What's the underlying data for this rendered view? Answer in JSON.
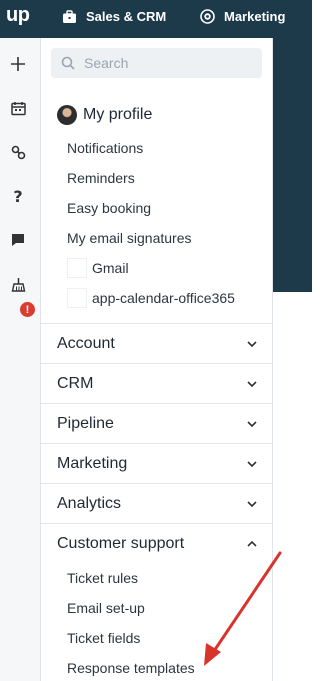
{
  "topbar": {
    "logo": "up",
    "nav": [
      {
        "label": "Sales & CRM",
        "icon": "briefcase-icon"
      },
      {
        "label": "Marketing",
        "icon": "target-icon"
      }
    ]
  },
  "rail": {
    "icons": [
      "plus-icon",
      "calendar-icon",
      "link-icon",
      "help-icon",
      "chat-icon",
      "alert-icon"
    ],
    "badge": "!"
  },
  "search": {
    "placeholder": "Search"
  },
  "profile": {
    "label": "My profile",
    "items": [
      "Notifications",
      "Reminders",
      "Easy booking",
      "My email signatures"
    ],
    "signatures": [
      "Gmail",
      "app-calendar-office365"
    ]
  },
  "sections": [
    {
      "label": "Account",
      "expanded": false
    },
    {
      "label": "CRM",
      "expanded": false
    },
    {
      "label": "Pipeline",
      "expanded": false
    },
    {
      "label": "Marketing",
      "expanded": false
    },
    {
      "label": "Analytics",
      "expanded": false
    },
    {
      "label": "Customer support",
      "expanded": true
    }
  ],
  "customer_support_items": [
    "Ticket rules",
    "Email set-up",
    "Ticket fields",
    "Response templates"
  ],
  "colors": {
    "topbar": "#1c3a4a",
    "annotation_arrow": "#d9342b",
    "badge": "#d93d32"
  }
}
